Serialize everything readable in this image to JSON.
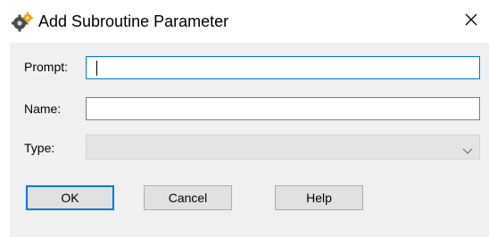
{
  "window": {
    "title": "Add Subroutine Parameter",
    "icon": "subroutine-gears-icon",
    "close_glyph": "✕"
  },
  "form": {
    "prompt_label": "Prompt:",
    "prompt_value": "",
    "name_label": "Name:",
    "name_value": "",
    "type_label": "Type:",
    "type_value": ""
  },
  "buttons": {
    "ok": "OK",
    "cancel": "Cancel",
    "help": "Help"
  },
  "colors": {
    "accent": "#0078d7",
    "client_bg": "#f0f0f0",
    "button_bg": "#e1e1e1",
    "disabled_combo_bg": "#e5e5e5"
  }
}
